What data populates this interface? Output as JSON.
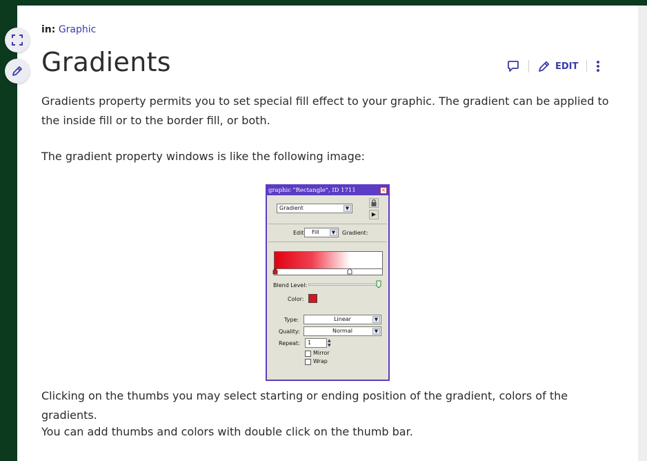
{
  "breadcrumb": {
    "prefix": "in:",
    "link": "Graphic"
  },
  "page_title": "Gradients",
  "actions": {
    "edit_label": "EDIT"
  },
  "paragraphs": {
    "intro": "Gradients property permits you to set special fill effect to your graphic. The gradient can be applied to the inside fill or to the border fill, or both.",
    "window_note": "The gradient property windows is like the following image:",
    "thumbs_note": "Clicking on the thumbs you may select starting or ending position of the gradient, colors of the gradients.",
    "add_note": "You can add thumbs and colors with double click on the thumb bar."
  },
  "dialog": {
    "title": "graphic \"Rectangle\", ID 1711",
    "category": "Gradient",
    "edit_label": "Edit",
    "edit_value": "Fill",
    "gradient_label": "Gradient:",
    "blend_label": "Blend Level:",
    "color_label": "Color:",
    "type_label": "Type:",
    "type_value": "Linear",
    "quality_label": "Quality:",
    "quality_value": "Normal",
    "repeat_label": "Repeat:",
    "repeat_value": "1",
    "mirror_label": "Mirror",
    "wrap_label": "Wrap",
    "selected_color": "#d8141e"
  },
  "colors": {
    "accent": "#3a3aa8",
    "sidebar": "#0b3a1e",
    "dialog_border": "#5b3cc4"
  },
  "icons": [
    "expand-icon",
    "pencil-icon",
    "comment-icon",
    "edit-pencil-icon",
    "more-vertical-icon"
  ]
}
